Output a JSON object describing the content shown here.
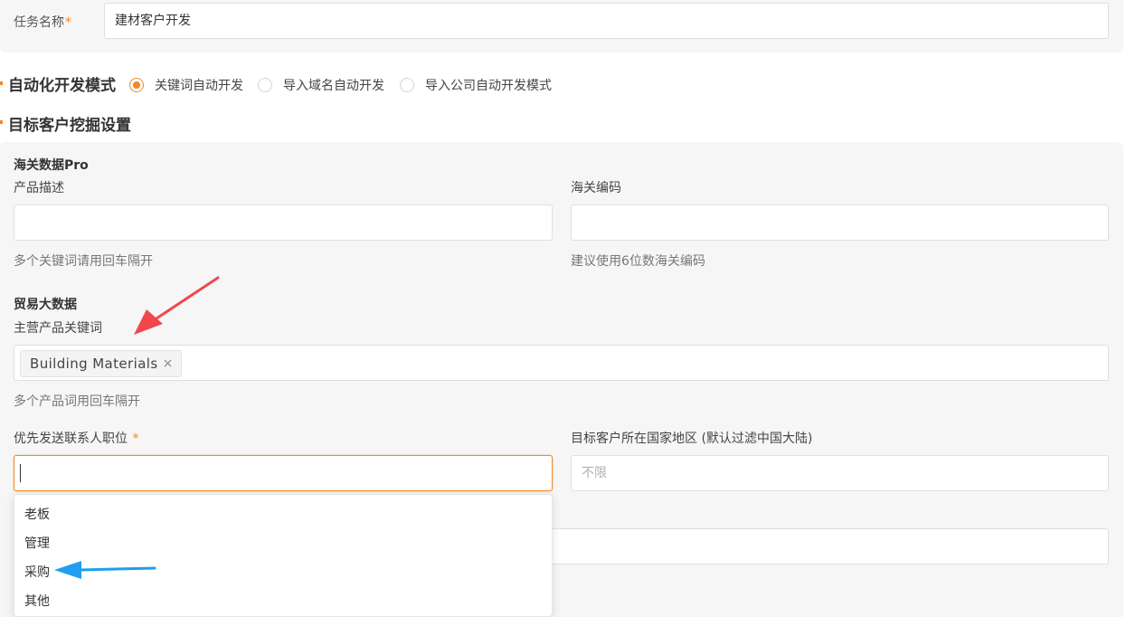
{
  "task": {
    "label": "任务名称",
    "required_mark": "*",
    "value": "建材客户开发"
  },
  "mode": {
    "title": "自动化开发模式",
    "options": [
      {
        "label": "关键词自动开发",
        "checked": true
      },
      {
        "label": "导入域名自动开发",
        "checked": false
      },
      {
        "label": "导入公司自动开发模式",
        "checked": false
      }
    ]
  },
  "mining": {
    "title": "目标客户挖掘设置"
  },
  "customs": {
    "title": "海关数据Pro",
    "product_desc_label": "产品描述",
    "product_desc_hint": "多个关键词请用回车隔开",
    "hs_code_label": "海关编码",
    "hs_code_hint": "建议使用6位数海关编码"
  },
  "trade": {
    "title": "贸易大数据",
    "keywords_label": "主营产品关键词",
    "keyword_tags": [
      "Building Materials"
    ],
    "tag_close": "×",
    "keywords_hint": "多个产品词用回车隔开"
  },
  "contact": {
    "position_label": "优先发送联系人职位",
    "required_mark": "*",
    "position_options": [
      "老板",
      "管理",
      "采购",
      "其他"
    ],
    "country_label": "目标客户所在国家地区 (默认过滤中国大陆)",
    "country_placeholder": "不限"
  },
  "colors": {
    "accent": "#f08a24",
    "red_arrow": "#f0484a",
    "blue_arrow": "#1e9ef0"
  }
}
